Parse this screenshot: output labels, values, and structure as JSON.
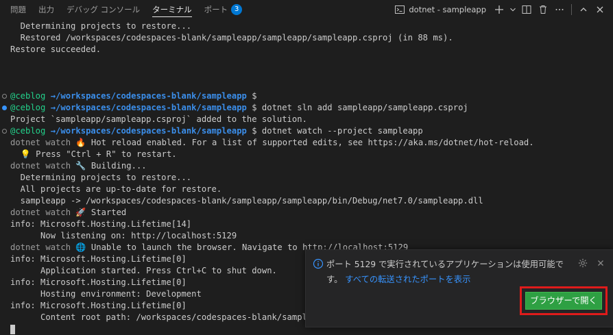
{
  "panel": {
    "tabs": [
      {
        "label": "問題"
      },
      {
        "label": "出力"
      },
      {
        "label": "デバッグ コンソール"
      },
      {
        "label": "ターミナル"
      },
      {
        "label": "ポート",
        "badge": "3"
      }
    ],
    "terminal_name": "dotnet - sampleapp"
  },
  "terminal": {
    "lines": [
      "  Determining projects to restore...",
      "  Restored /workspaces/codespaces-blank/sampleapp/sampleapp/sampleapp.csproj (in 88 ms).",
      "Restore succeeded.",
      "",
      "",
      "",
      "Project `sampleapp/sampleapp.csproj` added to the solution.",
      "",
      "dotnet watch 🔥 Hot reload enabled. For a list of supported edits, see https://aka.ms/dotnet/hot-reload.",
      "  💡 Press \"Ctrl + R\" to restart.",
      "dotnet watch 🔧 Building...",
      "  Determining projects to restore...",
      "  All projects are up-to-date for restore.",
      "  sampleapp -> /workspaces/codespaces-blank/sampleapp/sampleapp/bin/Debug/net7.0/sampleapp.dll",
      "dotnet watch 🚀 Started",
      "info: Microsoft.Hosting.Lifetime[14]",
      "      Now listening on: http://localhost:5129",
      "dotnet watch 🌐 Unable to launch the browser. Navigate to http://localhost:5129",
      "info: Microsoft.Hosting.Lifetime[0]",
      "      Application started. Press Ctrl+C to shut down.",
      "info: Microsoft.Hosting.Lifetime[0]",
      "      Hosting environment: Development",
      "info: Microsoft.Hosting.Lifetime[0]",
      "      Content root path: /workspaces/codespaces-blank/sampleap"
    ],
    "prompts": [
      {
        "line": 6,
        "user": "@ceblog",
        "path": "→/workspaces/codespaces-blank/sampleapp",
        "command": "$"
      },
      {
        "line": 7,
        "user": "@ceblog",
        "path": "→/workspaces/codespaces-blank/sampleapp",
        "command": "$ dotnet sln add sampleapp/sampleapp.csproj"
      },
      {
        "line": 9,
        "user": "@ceblog",
        "path": "→/workspaces/codespaces-blank/sampleapp",
        "command": "$ dotnet watch --project sampleapp"
      }
    ]
  },
  "notification": {
    "message": "ポート 5129 で実行されているアプリケーションは使用可能です。",
    "link": "すべての転送されたポートを表示",
    "button": "ブラウザーで開く"
  },
  "colors": {
    "background": "#1e1e1e",
    "user": "#23d18b",
    "path": "#3b8eea",
    "link": "#3794ff",
    "badge": "#0078d4",
    "button": "#2ea043",
    "highlight": "#e01b1b"
  }
}
